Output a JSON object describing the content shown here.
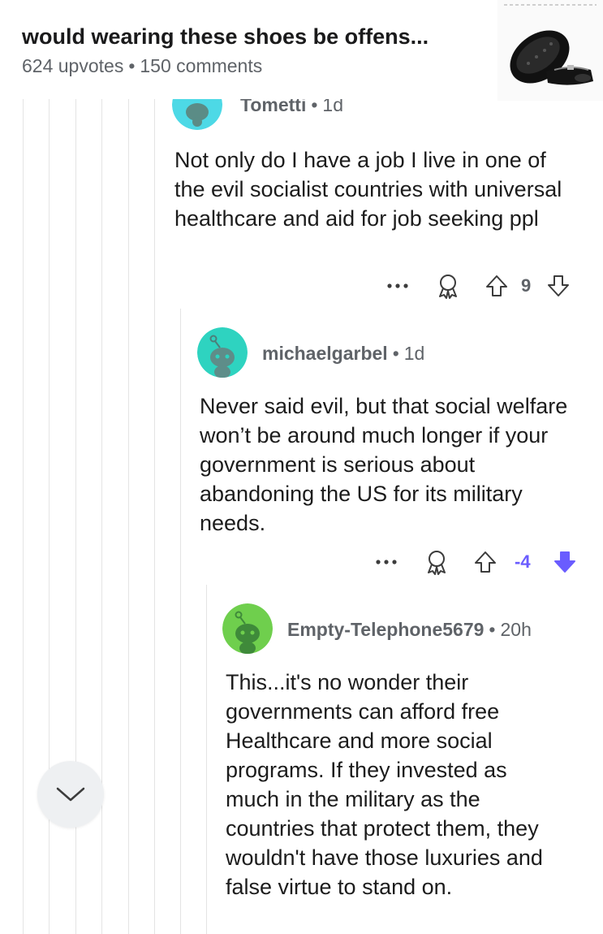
{
  "post": {
    "title": "would wearing these shoes be offens...",
    "upvotes": "624 upvotes",
    "comments": "150 comments",
    "thumbnail_icon": "mary-jane-shoes-icon"
  },
  "comments": [
    {
      "username": "Tometti",
      "age": "1d",
      "avatar_color": "#4dd9e6",
      "body": "Not only do I have a job I live in one of the evil socialist countries with universal healthcare and aid for job seeking ppl",
      "score": "9",
      "voted": "none"
    },
    {
      "username": "michaelgarbel",
      "age": "1d",
      "avatar_color": "#2ed3c0",
      "body": "Never said evil, but that social welfare won’t be around much longer if your government is serious about abandoning the US for its military needs.",
      "score": "-4",
      "voted": "down"
    },
    {
      "username": "Empty-Telephone5679",
      "age": "20h",
      "avatar_color": "#6fcf4d",
      "body": "This...it's no wonder their governments can afford free Healthcare and more social programs. If they invested as much in the military as the countries that protect them, they wouldn't have those luxuries and false virtue to stand on."
    }
  ],
  "colors": {
    "downvote_active": "#6a5cff",
    "thread_line": "#e4e4e4",
    "meta_text": "#5f6368"
  },
  "icons": {
    "more": "more-options-icon",
    "award": "award-icon",
    "upvote": "upvote-arrow-icon",
    "downvote": "downvote-arrow-icon",
    "scroll": "chevron-down-icon"
  }
}
